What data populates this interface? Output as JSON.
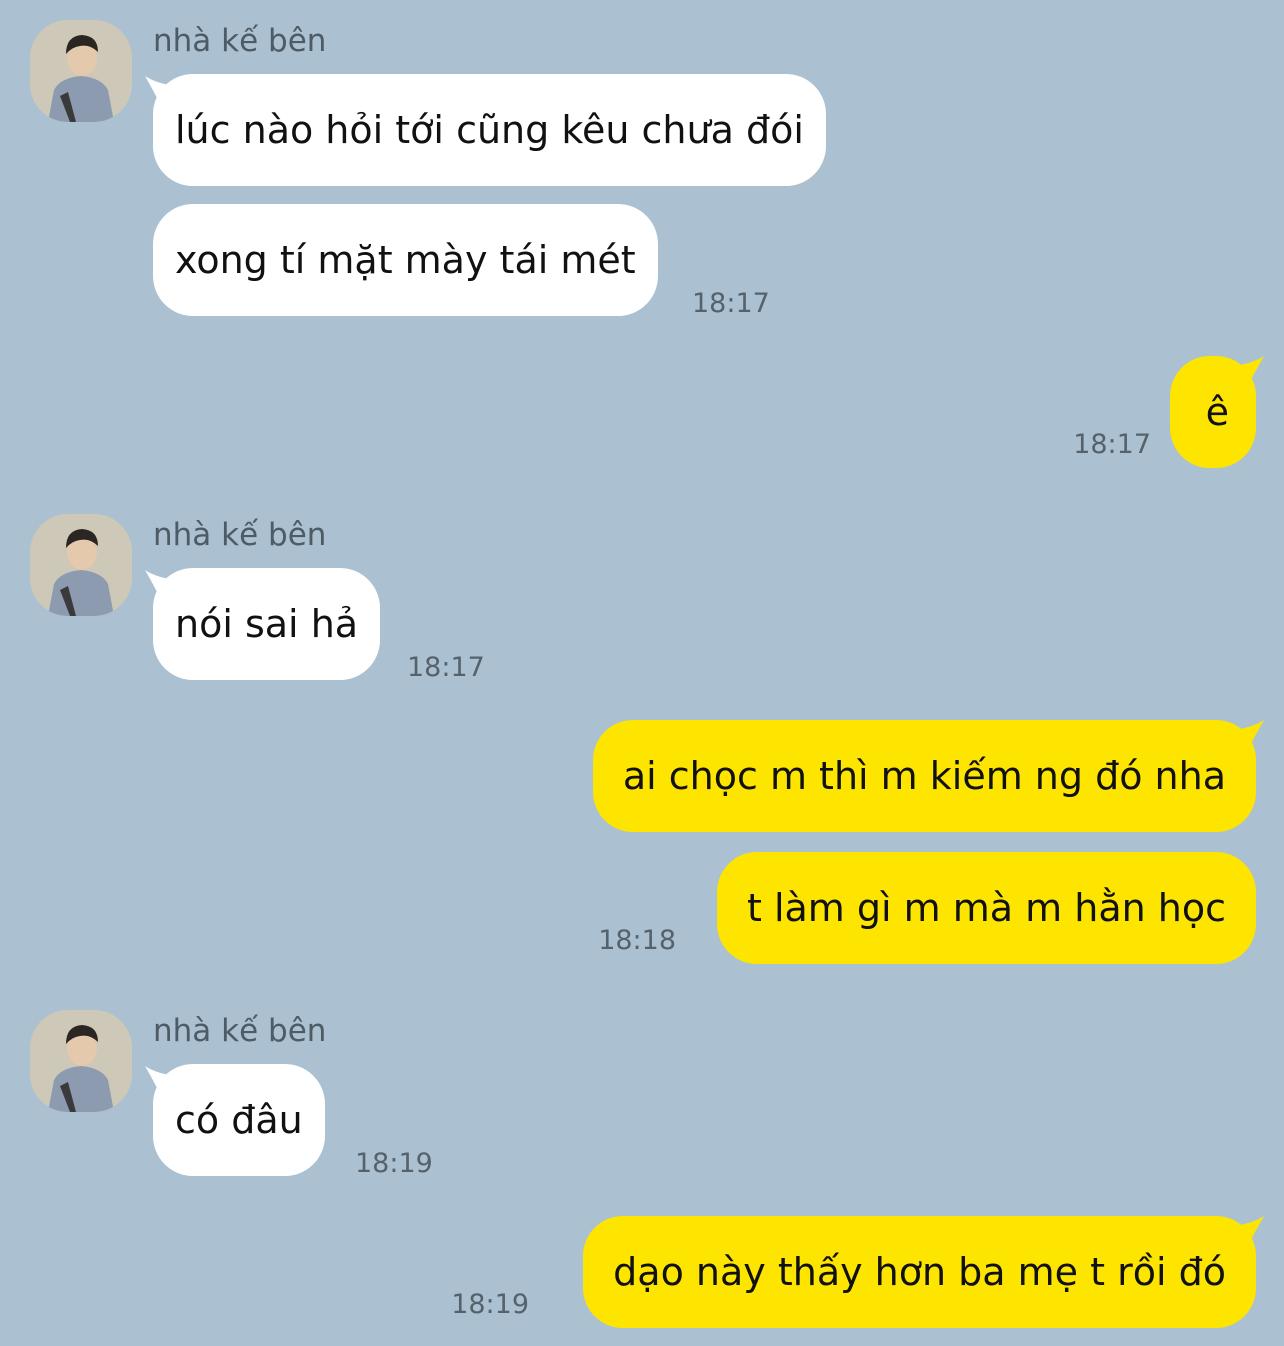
{
  "colors": {
    "background": "#abc1d1",
    "incoming_bubble": "#ffffff",
    "outgoing_bubble": "#fee500",
    "sender_text": "#4f5b64",
    "time_text": "#56626b"
  },
  "messages": [
    {
      "sender": "nhà kế bên",
      "text": "lúc nào hỏi tới cũng kêu chưa đói"
    },
    {
      "text": "xong tí mặt mày tái mét",
      "time": "18:17"
    },
    {
      "text": "ê",
      "time": "18:17"
    },
    {
      "sender": "nhà kế bên",
      "text": "nói sai hả",
      "time": "18:17"
    },
    {
      "text": "ai chọc m thì m kiếm ng đó nha"
    },
    {
      "text": "t làm gì m mà m hằn học",
      "time": "18:18"
    },
    {
      "sender": "nhà kế bên",
      "text": "có đâu",
      "time": "18:19"
    },
    {
      "text": "dạo này thấy hơn ba mẹ t rồi đó",
      "time": "18:19"
    }
  ]
}
